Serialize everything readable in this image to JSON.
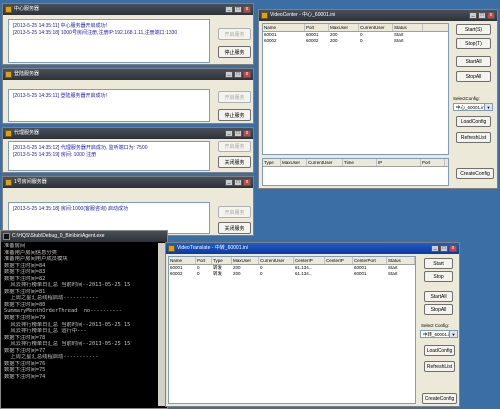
{
  "center_window": {
    "title": "中心服务器",
    "log": [
      "[2013-5-25 14:35:11] 中心服务器开启成功!",
      "[2013-5-25 14:35:18] 1000号房间注册,注册IP:192.168.1.11,注册端口:1330"
    ],
    "start_label": "开启服务",
    "stop_label": "停止服务"
  },
  "login_window": {
    "title": "登陆服务器",
    "log": [
      "[2013-5-25 14:35:11] 登陆服务器开启成功!"
    ],
    "start_label": "开启服务",
    "stop_label": "停止服务"
  },
  "proxy_window": {
    "title": "代理服务器",
    "log": [
      "[2013-5-25 14:35:12] 代理服务器开启成功, 监听端口为: 7500",
      "[2013-5-25 14:35:19] 房间: 1000 注册"
    ],
    "start_label": "开启服务",
    "stop_label": "关闭服务"
  },
  "room_window": {
    "title": "1号房间服务器",
    "log": [
      "[2013-5-25 14:35:18] 房间:1000(客服咨询) 启动成功"
    ],
    "start_label": "开启服务",
    "stop_label": "关闭服务"
  },
  "video_center": {
    "title": "VideoCenter - 中心_60001.ini",
    "top_columns": [
      "Name",
      "Port",
      "MaxUser",
      "CurrentUser",
      "Status"
    ],
    "top_rows": [
      [
        "60001",
        "60001",
        "200",
        "0",
        "Start"
      ],
      [
        "60002",
        "60002",
        "200",
        "0",
        "Start"
      ]
    ],
    "bottom_columns": [
      "Type",
      "MaxUser",
      "CurrentUser",
      "Time",
      "IP",
      "Port"
    ],
    "buttons": {
      "start": "Start(S)",
      "stop": "Stop(T)",
      "start_all": "StartAll",
      "stop_all": "StopAll",
      "load": "LoadConfig",
      "refresh": "RefreshList",
      "create": "CreateConfig"
    },
    "select_label": "SelectConfig:",
    "select_value": "中心_60001.ini"
  },
  "video_translate": {
    "title": "VideoTranslate - 中转_60001.ini",
    "columns": [
      "Name",
      "Port",
      "Type",
      "MaxUser",
      "CurrentUser",
      "CenterIP",
      "CenterIP",
      "CenterPort",
      "Status"
    ],
    "rows": [
      [
        "60001",
        "0",
        "转发",
        "200",
        "0",
        "61.134...",
        "",
        "60001",
        "Start"
      ],
      [
        "60002",
        "0",
        "转发",
        "200",
        "0",
        "61.134...",
        "",
        "60001",
        "Start"
      ]
    ],
    "buttons": {
      "start": "Start",
      "stop": "Stop",
      "start_all": "StartAll",
      "stop_all": "StopAll",
      "load": "LoadConfig",
      "refresh": "RefreshList",
      "create": "CreateConfig"
    },
    "select_label": "Select Config:",
    "select_value": "中转_60001.ini"
  },
  "console": {
    "title": "C:\\HQS\\Stub\\Debug_0_Bin\\bin\\Agent.exe",
    "lines": [
      "准备房间",
      "准备用户房间信息分类",
      "准备用户房间用户成员模块",
      "数据下注时间=84",
      "数据下注时间=83",
      "数据下注时间=82",
      "  风云排行榜单日汇总 当前时间--2013-05-25 15",
      "数据下注时间=81",
      "  上周之星汇总线程启动-----------",
      "数据下注时间=80",
      "SummaryMonthOrderThread  no----------",
      "数据下注时间=79",
      "  风云排行榜单日汇总 当前时间--2013-05-25 15",
      "  风云排行榜单日汇总 运行中---",
      "数据下注时间=78",
      "  风云排行榜单日汇总 当前时间--2013-05-25 15",
      "数据下注时间=77",
      "  上周之星汇总线程启动-----------",
      "数据下注时间=76",
      "数据下注时间=75",
      "数据下注时间=74"
    ]
  }
}
